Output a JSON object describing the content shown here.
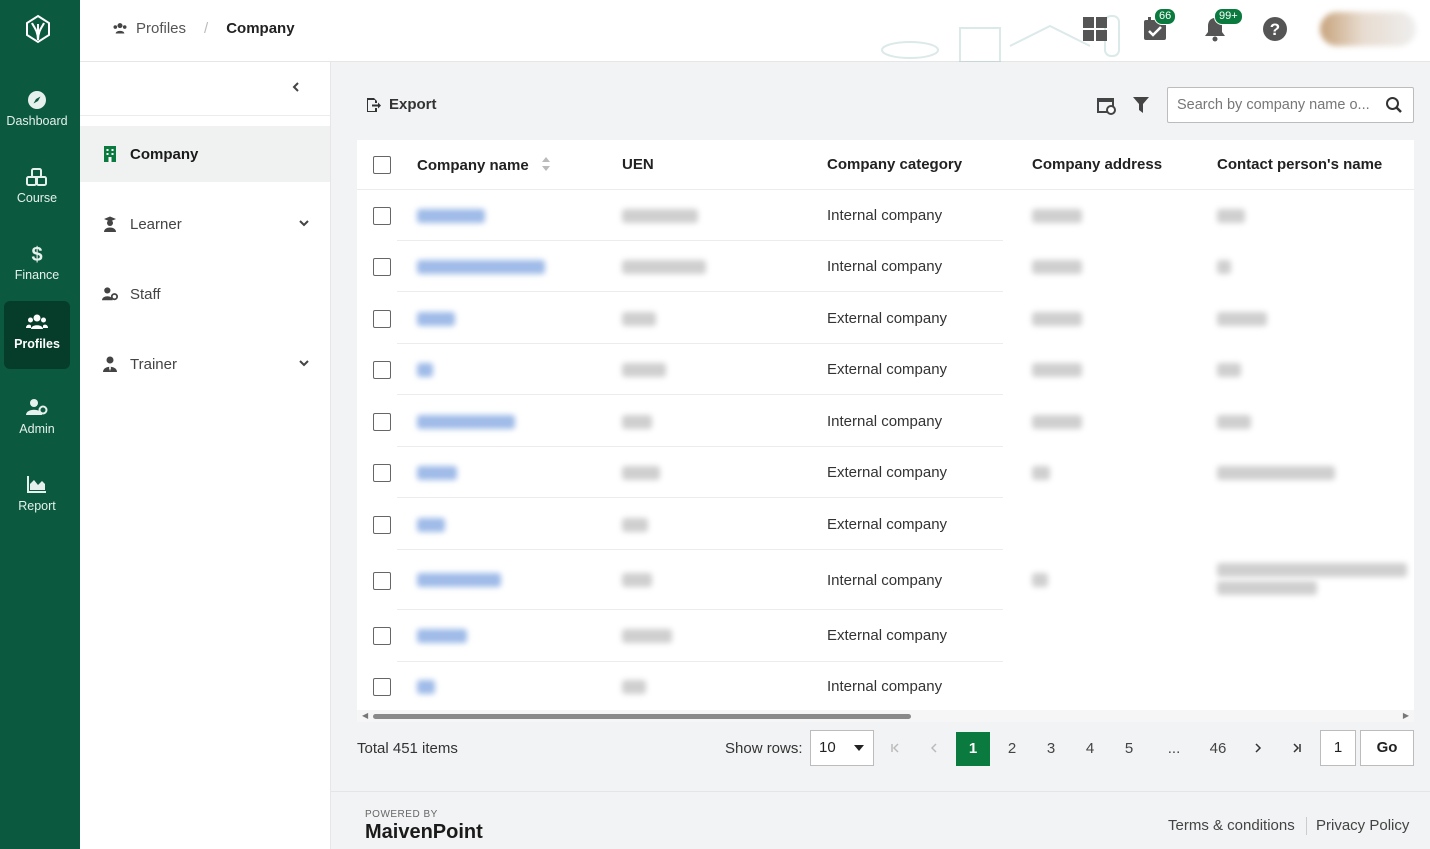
{
  "brand_color": "#0b5a3f",
  "accent_color": "#0b7a3f",
  "nav": {
    "logo_icon": "leaf-logo-icon",
    "items": [
      {
        "label": "Dashboard",
        "icon": "compass-icon"
      },
      {
        "label": "Course",
        "icon": "cubes-icon"
      },
      {
        "label": "Finance",
        "icon": "dollar-icon"
      },
      {
        "label": "Profiles",
        "icon": "users-icon",
        "active": true
      },
      {
        "label": "Admin",
        "icon": "user-cog-icon"
      },
      {
        "label": "Report",
        "icon": "area-chart-icon"
      }
    ]
  },
  "header": {
    "breadcrumb": {
      "parent": "Profiles",
      "current": "Company"
    },
    "tasks_count": "66",
    "notifications_count": "99+"
  },
  "sidebar": {
    "items": [
      {
        "label": "Company",
        "icon": "building-icon",
        "active": true
      },
      {
        "label": "Learner",
        "icon": "graduate-icon",
        "expandable": true
      },
      {
        "label": "Staff",
        "icon": "user-gear-icon"
      },
      {
        "label": "Trainer",
        "icon": "user-tie-icon",
        "expandable": true
      }
    ]
  },
  "toolbar": {
    "export_label": "Export",
    "search_placeholder": "Search by company name o..."
  },
  "table": {
    "columns": [
      "Company name",
      "UEN",
      "Company category",
      "Company address",
      "Contact person's name"
    ],
    "rows": [
      {
        "category": "Internal company"
      },
      {
        "category": "Internal company"
      },
      {
        "category": "External company"
      },
      {
        "category": "External company"
      },
      {
        "category": "Internal company"
      },
      {
        "category": "External company"
      },
      {
        "category": "External company"
      },
      {
        "category": "Internal company"
      },
      {
        "category": "External company"
      },
      {
        "category": "Internal company"
      }
    ]
  },
  "pagination": {
    "total_label": "Total 451 items",
    "show_rows_label": "Show rows:",
    "rows_per_page": "10",
    "pages": [
      "1",
      "2",
      "3",
      "4",
      "5",
      "...",
      "46"
    ],
    "current_page": "1",
    "goto_value": "1",
    "go_label": "Go"
  },
  "footer": {
    "powered_by": "POWERED BY",
    "brand": "MaivenPoint",
    "terms": "Terms & conditions",
    "privacy": "Privacy Policy"
  }
}
